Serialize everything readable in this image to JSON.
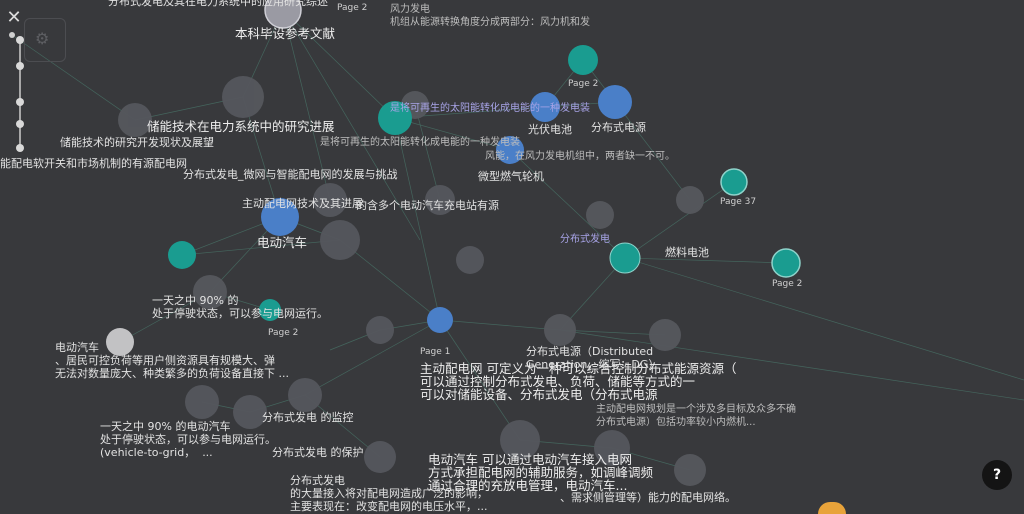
{
  "controls": {
    "close_glyph": "✕",
    "settings_glyph": "⚙",
    "help_label": "?"
  },
  "colors": {
    "background": "#38393c",
    "node_gray": "#55575d",
    "node_teal": "#1a9c90",
    "node_blue": "#4a7fc8",
    "edge_green": "#4f8a79",
    "label_purple": "#a7a3e6"
  },
  "graph": {
    "labels": [
      "分布式发电及其在电力系统中的应用研究综述",
      "Page 2",
      "风力发电\n机组从能源转换角度分成两部分：风力机和发",
      "本科毕设参考文献",
      "Page 2",
      "是将可再生的太阳能转化成电能的一种发电装",
      "光伏电池",
      "分布式电源",
      "储能技术的研究开发现状及展望",
      "储能技术在电力系统中的研究进展",
      "是将可再生的太阳能转化成电能的一种发电装",
      "风能，在风力发电机组中，两者缺一不可。",
      "能配电软开关和市场机制的有源配电网",
      "分布式发电_微网与智能配电网的发展与挑战",
      "微型燃气轮机",
      "Page 37",
      "主动配电网技术及其进展",
      "的含多个电动汽车充电站有源",
      "电动汽车",
      "燃料电池",
      "分布式发电",
      "Page 2",
      "一天之中 90% 的\n处于停驶状态，可以参与电网运行。",
      "电动汽车\n、居民可控负荷等用户侧资源具有规模大、弹\n无法对数量庞大、种类繁多的负荷设备直接下 ...",
      "Page 2",
      "Page 1",
      "一天之中 90% 的电动汽车\n处于停驶状态，可以参与电网运行。\n(vehicle-to-grid，  ...",
      "分布式发电 的监控",
      "分布式发电 的保护",
      "分布式发电\n的大量接入将对配电网造成广泛的影响，\n主要表现在：改变配电网的电压水平，...",
      "主动配电网 可定义为一种可以综合控制分布式能源资源（\n可以通过控制分布式发电、负荷、储能等方式的一\n可以对储能设备、分布式发电（分布式电源",
      "分布式电源（Distributed\nGeneration，缩写：DG）",
      "主动配电网规划是一个涉及多目标及众多不确\n分布式电源）包括功率较小内燃机...",
      "电动汽车 可以通过电动汽车接入电网\n方式承担配电网的辅助服务，如调峰调频\n通过合理的充放电管理，电动汽车...",
      "、需求侧管理等）能力的配电网络。"
    ]
  }
}
